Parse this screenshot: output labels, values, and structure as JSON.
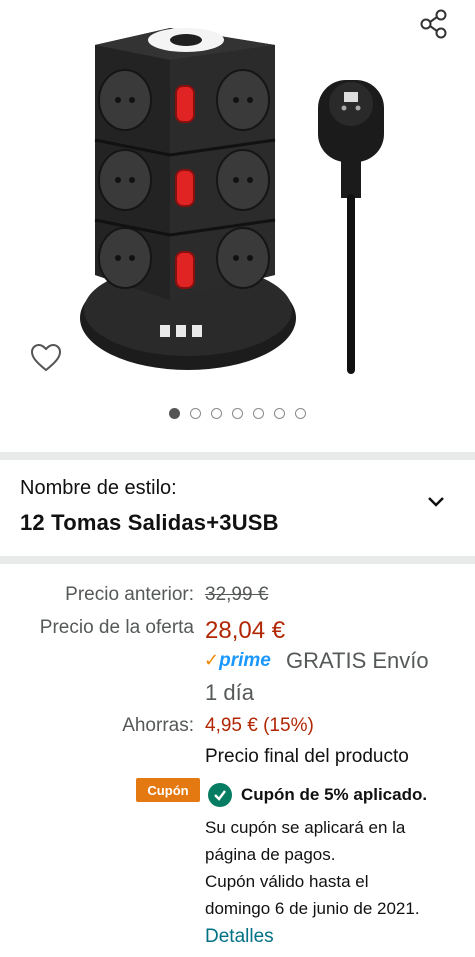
{
  "product_image": {
    "carousel_count": 7,
    "active_index": 0
  },
  "icons": {
    "share": "share-icon",
    "wishlist": "heart-icon",
    "dropdown": "chevron-down-icon",
    "check": "check-circle-icon"
  },
  "style": {
    "label": "Nombre de estilo:",
    "value": "12 Tomas Salidas+3USB"
  },
  "pricing": {
    "previous_label": "Precio anterior:",
    "previous_price": "32,99 €",
    "offer_label": "Precio de la oferta",
    "offer_price": "28,04 €",
    "prime_check": "✓",
    "prime_logo": "prime",
    "shipping_line1": "GRATIS Envío",
    "shipping_line2": "1 día",
    "savings_label": "Ahorras:",
    "savings_value": "4,95 € (15%)",
    "final_price_note": "Precio final del producto"
  },
  "coupon": {
    "badge": "Cupón",
    "applied": "Cupón de 5% aplicado.",
    "notes": [
      "Su cupón se aplicará en la",
      "página de pagos.",
      "Cupón válido hasta el",
      "domingo 6 de junio de 2021."
    ],
    "details_link": "Detalles"
  },
  "colors": {
    "price_red": "#b12704",
    "link_teal": "#007185",
    "coupon_orange": "#e47911",
    "check_green": "#067d62",
    "prime_blue": "#1a98ff"
  }
}
